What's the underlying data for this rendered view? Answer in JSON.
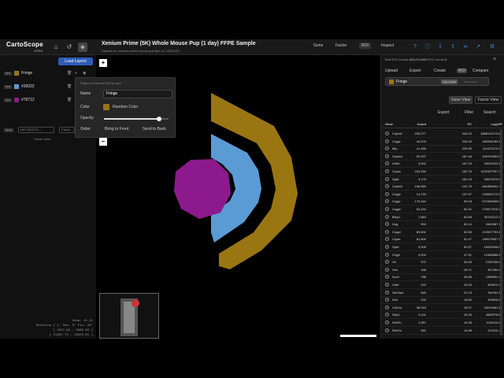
{
  "app": {
    "logo": "CartoScope",
    "logo_sub": "OPEN",
    "title": "Xenium Prime (5K) Whole Mouse Pup (1 day) FFPE Sample",
    "dataset": "Dataset ID: xenium-prime-mouse-pup-ffpe-v2-20251201",
    "tools": [
      "Gene",
      "Factor",
      "ROI",
      "Inspect"
    ]
  },
  "left": {
    "load_layers": "Load Layers",
    "layers": [
      {
        "tag": "ROI",
        "name": "Fringe",
        "color": "#9a7612"
      },
      {
        "tag": "ROI",
        "name": "#39022",
        "color": "#5b9bd5"
      },
      {
        "tag": "ROI",
        "name": "#78712",
        "color": "#8c1a8c"
      }
    ],
    "factor_tag": "Factor",
    "factor_select": "HIF-F(EZ-F1...",
    "factor_select2": "Factor",
    "factor_view": "Factor View",
    "zoom_label": "Zoom: 15.31",
    "rotation_label": "Rotation [°]: Pan: 0° Fix: 20°",
    "coord1": "[ 4521.94 , 9989.68 ]",
    "coord2": "[ 21407.74 , 13823.61 ]"
  },
  "popup": {
    "header": "Region of interest (ROI) layer",
    "name_label": "Name",
    "name_value": "Fringe",
    "color_label": "Color",
    "random_color": "Random Color",
    "opacity_label": "Opacity",
    "opacity": 0.85,
    "order_label": "Order",
    "bring_front": "Bring to Front",
    "send_back": "Send to Back"
  },
  "viewer": {
    "zoom_in": "+",
    "zoom_out": "−",
    "shapes": {
      "fringe": "#9a7612",
      "blue": "#5b9bd5",
      "purple": "#8c1a8c"
    }
  },
  "right": {
    "total_counts": "Total ROI Counts",
    "total_value": "523,674,985",
    "roi_count": "ROI Counts",
    "roi_count_value": "3",
    "buttons": [
      "Upload",
      "Export",
      "Create",
      "ROI",
      "Compare"
    ],
    "selected_roi": "Fringe",
    "badge": "Fully Loaded",
    "roi_counts_small": "ROI Counts",
    "tabs": [
      "Gene View",
      "Factor View"
    ],
    "actions": [
      "Export",
      "Filter",
      "Search"
    ],
    "columns": [
      "Gene",
      "Count",
      "FC",
      "Log10P"
    ],
    "rows": [
      [
        "Cryba2",
        "205,277",
        "243.22",
        "1868122179.68"
      ],
      [
        "Crygs",
        "44,976",
        "234.93",
        "455348784.83"
      ],
      [
        "Mip",
        "41,289",
        "229.99",
        "411123179.16"
      ],
      [
        "Crybb4",
        "52,097",
        "167.46",
        "409370953.05"
      ],
      [
        "Grifin",
        "3,001",
        "167.23",
        "25003423.10"
      ],
      [
        "Cryaa",
        "163,330",
        "162.76",
        "1102327997.33"
      ],
      [
        "Gja8",
        "3,175",
        "162.23",
        "25874275.01"
      ],
      [
        "Crybb3",
        "106,969",
        "142.79",
        "681858494.76"
      ],
      [
        "Crygb",
        "14,753",
        "137.97",
        "226643712.67"
      ],
      [
        "Crygc",
        "175,164",
        "99.18",
        "672450506.07"
      ],
      [
        "Crygb",
        "63,204",
        "83.31",
        "270677676.42"
      ],
      [
        "Bfsp1",
        "7,863",
        "63.58",
        "30742212.42"
      ],
      [
        "Gcg",
        "904",
        "60.14",
        "3462887.15"
      ],
      [
        "Crygd",
        "89,802",
        "53.55",
        "213927753.10"
      ],
      [
        "Crysb",
        "81,809",
        "51.47",
        "189979537.32"
      ],
      [
        "Gja3",
        "3,205",
        "50.57",
        "10059206.07"
      ],
      [
        "Crygf",
        "4,202",
        "47.51",
        "12385568.10"
      ],
      [
        "Vit",
        "972",
        "34.63",
        "2153768.20"
      ],
      [
        "Gck",
        "166",
        "28.71",
        "307454.98"
      ],
      [
        "Sox1",
        "786",
        "26.88",
        "1355901.49"
      ],
      [
        "Cdrlr",
        "222",
        "24.53",
        "390672.42"
      ],
      [
        "Slc24a4",
        "540",
        "22.13",
        "764761.50"
      ],
      [
        "Dri4",
        "133",
        "18.82",
        "159626.29"
      ],
      [
        "Cd24a",
        "38,015",
        "16.07",
        "24615961.82"
      ],
      [
        "Sfrp1",
        "5,211",
        "15.29",
        "4560978.54"
      ],
      [
        "Wnt7b",
        "1,357",
        "15.28",
        "1240110.80"
      ],
      [
        "Wnt7a",
        "452",
        "14.68",
        "412231.11"
      ]
    ]
  }
}
